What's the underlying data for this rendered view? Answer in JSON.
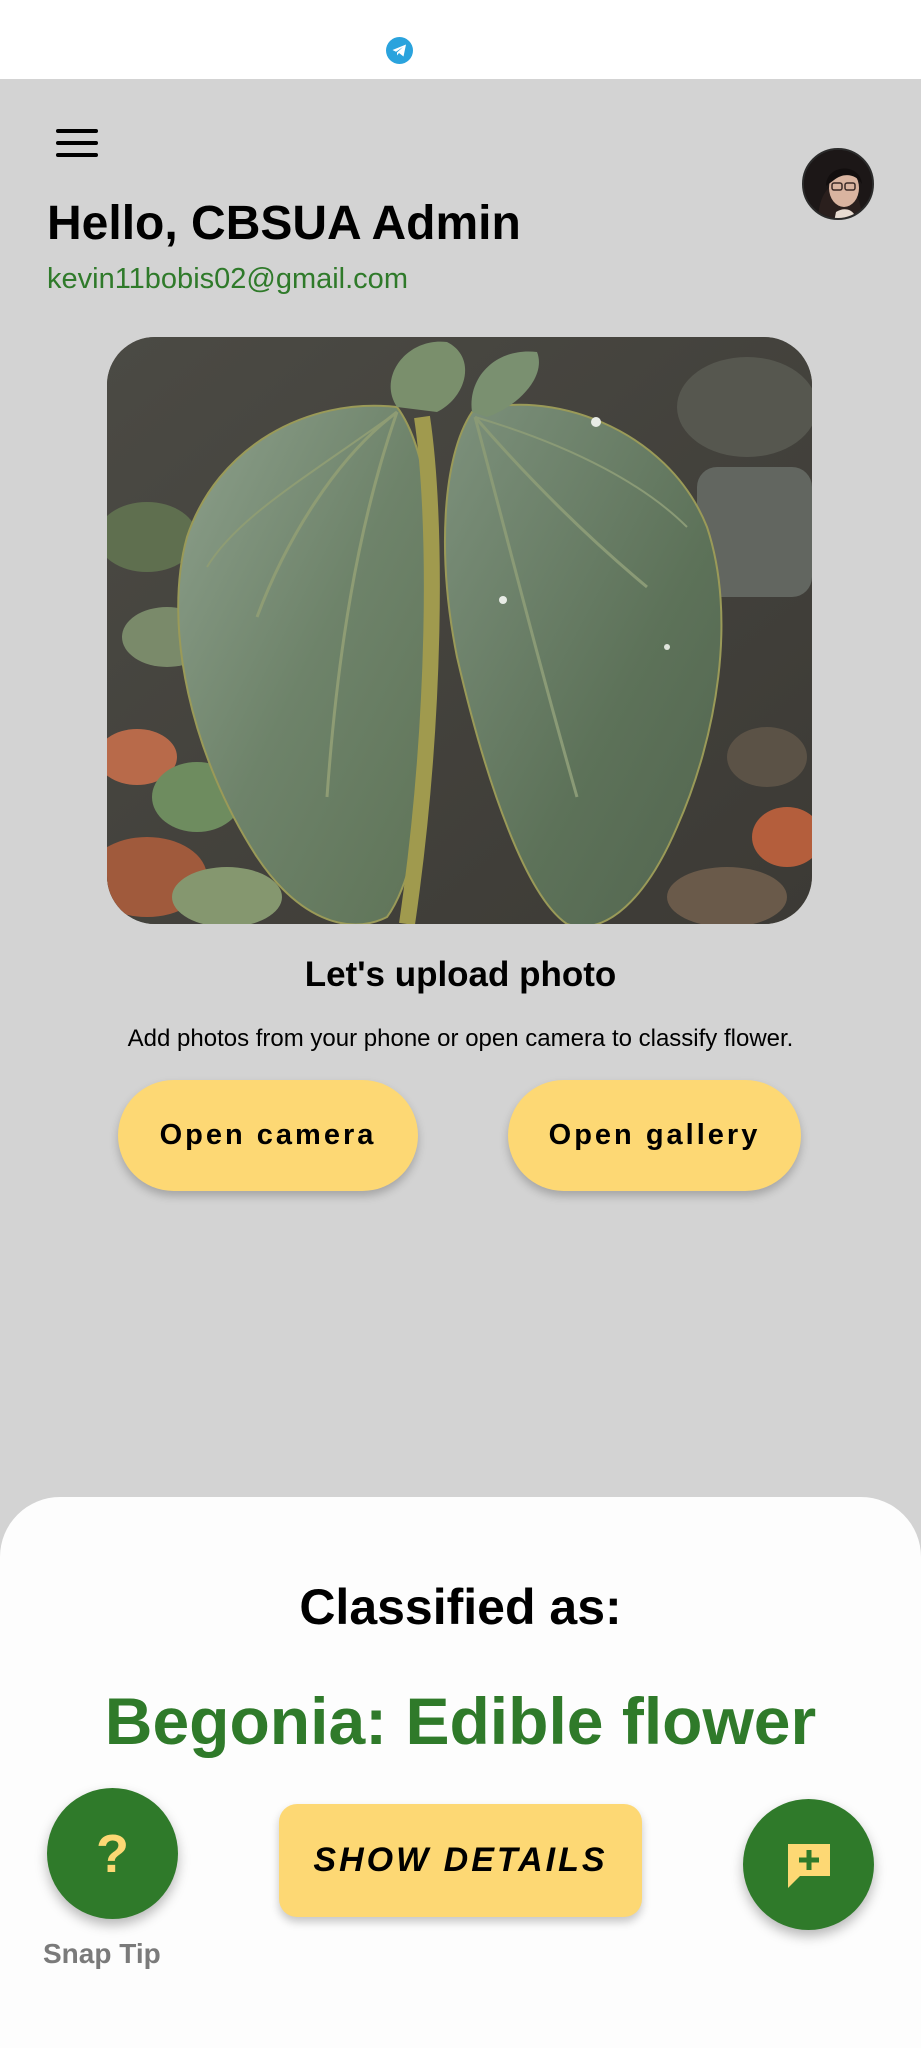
{
  "status_bar": {
    "icon": "telegram-icon"
  },
  "header": {
    "menu_icon": "hamburger-menu-icon",
    "greeting": "Hello, CBSUA Admin",
    "email": "kevin11bobis02@gmail.com"
  },
  "upload": {
    "title": "Let's upload photo",
    "subtitle": "Add photos from your phone or open camera to classify flower.",
    "camera_label": "Open camera",
    "gallery_label": "Open gallery"
  },
  "result": {
    "label": "Classified as:",
    "value": "Begonia: Edible flower",
    "details_label": "SHOW DETAILS"
  },
  "fabs": {
    "help_glyph": "?",
    "help_caption": "Snap Tip",
    "chat_icon": "add-comment-icon"
  },
  "colors": {
    "background": "#d3d3d3",
    "accent_green": "#2f7a2a",
    "button_yellow": "#fdd874",
    "sheet": "#fdfdfd"
  }
}
